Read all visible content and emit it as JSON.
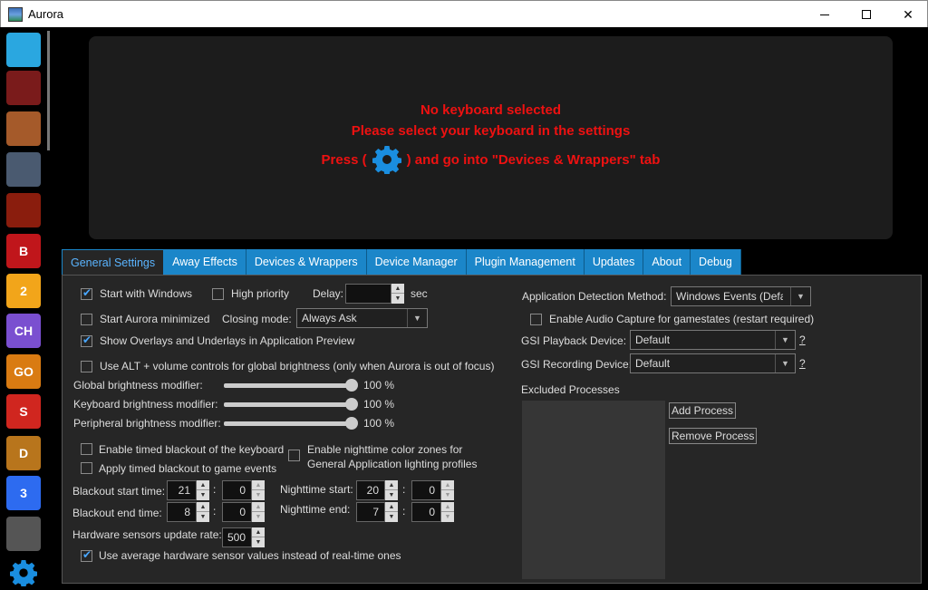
{
  "window": {
    "title": "Aurora"
  },
  "sidebar": {
    "icons": [
      {
        "name": "desktop-icon",
        "color": "#2aa7e0",
        "glyph": ""
      },
      {
        "name": "truck-icon",
        "color": "#7a1b1b",
        "glyph": ""
      },
      {
        "name": "battlefield-icon",
        "color": "#a55a2a",
        "glyph": ""
      },
      {
        "name": "soldier-icon",
        "color": "#4a5a70",
        "glyph": ""
      },
      {
        "name": "skull-icon",
        "color": "#8a1d0d",
        "glyph": ""
      },
      {
        "name": "b-red-icon",
        "color": "#c0161b",
        "glyph": "B"
      },
      {
        "name": "two-icon",
        "color": "#f2a51a",
        "glyph": "2"
      },
      {
        "name": "ch-icon",
        "color": "#7a4fd0",
        "glyph": "CH"
      },
      {
        "name": "csgo-icon",
        "color": "#d97b12",
        "glyph": "GO"
      },
      {
        "name": "flame-icon",
        "color": "#d0261f",
        "glyph": "S"
      },
      {
        "name": "d-icon",
        "color": "#b8751c",
        "glyph": "D"
      },
      {
        "name": "three-icon",
        "color": "#2d6bf0",
        "glyph": "3"
      },
      {
        "name": "dishonored-icon",
        "color": "#555",
        "glyph": ""
      },
      {
        "name": "settings-gear-icon",
        "color": "#1a8ee0",
        "glyph": ""
      }
    ]
  },
  "preview": {
    "line1": "No keyboard selected",
    "line2": "Please select your keyboard in the settings",
    "line3_pre": "Press (",
    "line3_post": ") and go into \"Devices & Wrappers\" tab",
    "color": "#e11111"
  },
  "tabs": [
    "General Settings",
    "Away Effects",
    "Devices & Wrappers",
    "Device Manager",
    "Plugin Management",
    "Updates",
    "About",
    "Debug"
  ],
  "general": {
    "start_with_windows": "Start with Windows",
    "high_priority": "High priority",
    "delay_label": "Delay:",
    "delay_value": "",
    "delay_unit": "sec",
    "start_minimized": "Start Aurora minimized",
    "closing_mode_label": "Closing mode:",
    "closing_mode_value": "Always Ask",
    "show_overlays": "Show Overlays and Underlays in Application Preview",
    "alt_volume": "Use ALT + volume controls for global brightness (only when Aurora is out of focus)",
    "global_brightness_label": "Global brightness modifier:",
    "global_brightness_value": "100 %",
    "global_brightness_level": 1.0,
    "keyboard_brightness_label": "Keyboard brightness modifier:",
    "keyboard_brightness_value": "100 %",
    "keyboard_brightness_level": 1.0,
    "peripheral_brightness_label": "Peripheral brightness modifier:",
    "peripheral_brightness_value": "100 %",
    "peripheral_brightness_level": 1.0,
    "timed_blackout_keyboard": "Enable timed blackout of the keyboard",
    "timed_blackout_games": "Apply timed blackout to game events",
    "nighttime_zones_1": "Enable nighttime color zones for",
    "nighttime_zones_2": "General Application lighting profiles",
    "blackout_start_label": "Blackout start time:",
    "blackout_start_h": "21",
    "blackout_start_m": "0",
    "blackout_end_label": "Blackout end time:",
    "blackout_end_h": "8",
    "blackout_end_m": "0",
    "nighttime_start_label": "Nighttime start:",
    "nighttime_start_h": "20",
    "nighttime_start_m": "0",
    "nighttime_end_label": "Nighttime end:",
    "nighttime_end_h": "7",
    "nighttime_end_m": "0",
    "colon": ":",
    "hw_rate_label": "Hardware sensors update rate:",
    "hw_rate_value": "500",
    "avg_sensors": "Use average hardware sensor values instead of real-time ones",
    "detection_label": "Application Detection Method:",
    "detection_value": "Windows Events (Defa",
    "audio_capture": "Enable Audio Capture for gamestates (restart required)",
    "gsi_playback_label": "GSI Playback Device:",
    "gsi_playback_value": "Default",
    "gsi_recording_label": "GSI Recording Device:",
    "gsi_recording_value": "Default",
    "help_mark": "?",
    "excluded_label": "Excluded Processes",
    "add_process": "Add Process",
    "remove_process": "Remove Process"
  }
}
